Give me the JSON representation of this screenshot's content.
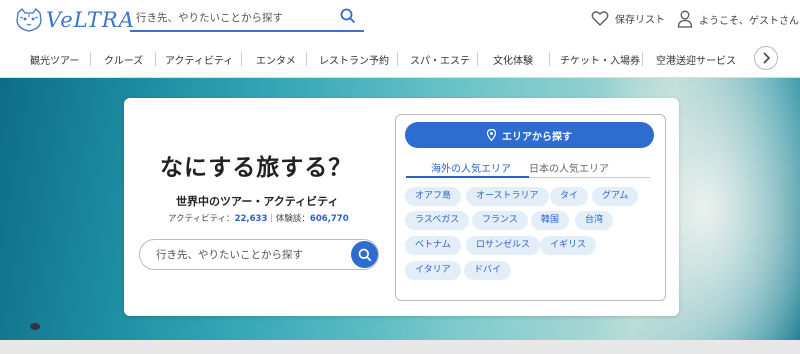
{
  "header": {
    "logo_text": "VeLTRA",
    "search_placeholder": "行き先、やりたいことから探す",
    "favorites_label": "保存リスト",
    "user_label": "ようこそ、ゲストさん"
  },
  "nav": {
    "items": [
      "観光ツアー",
      "クルーズ",
      "アクティビティ",
      "エンタメ",
      "レストラン予約",
      "スパ・エステ",
      "文化体験",
      "チケット・入場券",
      "空港送迎サービス"
    ]
  },
  "hero": {
    "title": "なにする旅する？",
    "subtitle": "世界中のツアー・アクティビティ",
    "stats_activities_label": "アクティビティ：",
    "stats_activities_value": "22,633",
    "stats_sep": "｜",
    "stats_reviews_label": "体験談：",
    "stats_reviews_value": "606,770",
    "search_placeholder": "行き先、やりたいことから探す"
  },
  "area_panel": {
    "button_label": "エリアから探す",
    "tabs": [
      {
        "label": "海外の人気エリア",
        "active": true
      },
      {
        "label": "日本の人気エリア",
        "active": false
      }
    ],
    "chips": [
      "オアフ島",
      "オーストラリア",
      "タイ",
      "グアム",
      "ラスベガス",
      "フランス",
      "韓国",
      "台湾",
      "ベトナム",
      "ロサンゼルス",
      "イギリス",
      "イタリア",
      "ドバイ"
    ]
  },
  "colors": {
    "accent": "#2f6ccf",
    "chip_bg": "#e4eef9"
  }
}
